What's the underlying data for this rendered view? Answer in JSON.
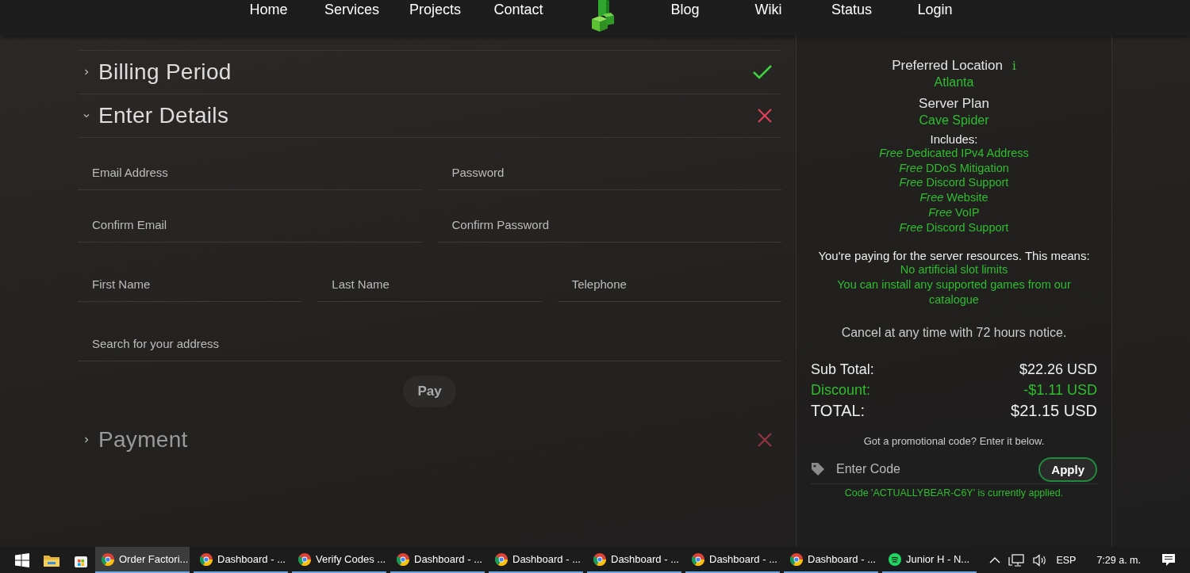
{
  "nav": {
    "items": [
      {
        "label": "Home"
      },
      {
        "label": "Services"
      },
      {
        "label": "Projects"
      },
      {
        "label": "Contact"
      },
      {
        "kind": "logo"
      },
      {
        "label": "Blog"
      },
      {
        "label": "Wiki"
      },
      {
        "label": "Status"
      },
      {
        "label": "Login"
      }
    ]
  },
  "sections": [
    {
      "title": "Billing Period",
      "expanded": false,
      "complete": true,
      "disabled": false
    },
    {
      "title": "Enter Details",
      "expanded": true,
      "complete": false,
      "disabled": false,
      "field_rows": [
        [
          {
            "placeholder": "Email Address"
          },
          {
            "placeholder": "Password"
          }
        ],
        [
          {
            "placeholder": "Confirm Email"
          },
          {
            "placeholder": "Confirm Password"
          }
        ],
        [
          {
            "placeholder": "First Name"
          },
          {
            "placeholder": "Last Name"
          },
          {
            "placeholder": "Telephone"
          }
        ],
        [
          {
            "placeholder": "Search for your address"
          }
        ]
      ],
      "button": "Pay"
    },
    {
      "title": "Payment",
      "expanded": false,
      "complete": false,
      "disabled": true
    }
  ],
  "summary": {
    "location_label": "Preferred Location",
    "info_icon": "i",
    "location": "Atlanta",
    "plan_label": "Server Plan",
    "plan": "Cave Spider",
    "includes_label": "Includes:",
    "includes": [
      "*Free* Dedicated IPv4 Address",
      "*Free* DDoS Mitigation",
      "*Free* Discord Support",
      "*Free* Website",
      "*Free* VoIP",
      "*Free* Discord Support"
    ],
    "resources_note": "You're paying for the server resources. This means:",
    "benefits": [
      "No artificial slot limits",
      "You can install any supported games from our catalogue"
    ],
    "cancel_note": "Cancel at any time with 72 hours notice.",
    "totals": [
      {
        "label": "Sub Total:",
        "value": "$22.26 USD",
        "kind": "normal"
      },
      {
        "label": "Discount:",
        "value": "-$1.11 USD",
        "kind": "discount"
      },
      {
        "label": "TOTAL:",
        "value": "$21.15 USD",
        "kind": "total"
      }
    ],
    "promo_prompt": "Got a promotional code? Enter it below.",
    "promo_placeholder": "Enter Code",
    "apply": "Apply",
    "promo_status": "Code 'ACTUALLYBEAR-C6Y' is currently applied."
  },
  "taskbar": {
    "tasks": [
      {
        "label": "Order Factori...",
        "kind": "chrome",
        "selected": true
      },
      {
        "label": "Dashboard - ...",
        "kind": "chrome",
        "selected": false
      },
      {
        "label": "Verify Codes ...",
        "kind": "chrome",
        "selected": false
      },
      {
        "label": "Dashboard - ...",
        "kind": "chrome",
        "selected": false
      },
      {
        "label": "Dashboard - ...",
        "kind": "chrome",
        "selected": false
      },
      {
        "label": "Dashboard - ...",
        "kind": "chrome",
        "selected": false
      },
      {
        "label": "Dashboard - ...",
        "kind": "chrome",
        "selected": false
      },
      {
        "label": "Dashboard - ...",
        "kind": "chrome",
        "selected": false
      },
      {
        "label": "Junior H - N...",
        "kind": "spotify",
        "selected": false
      }
    ],
    "language": "ESP",
    "time": "7:29 a. m."
  }
}
